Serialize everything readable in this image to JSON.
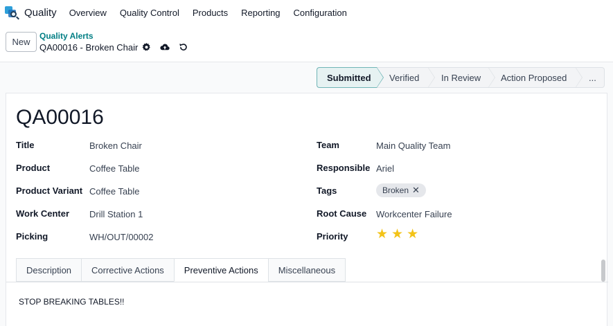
{
  "navbar": {
    "app_name": "Quality",
    "menu": [
      "Overview",
      "Quality Control",
      "Products",
      "Reporting",
      "Configuration"
    ]
  },
  "control": {
    "new_label": "New",
    "breadcrumb_parent": "Quality Alerts",
    "breadcrumb_current": "QA00016 - Broken Chair",
    "icons": [
      "gear-icon",
      "cloud-upload-icon",
      "undo-icon"
    ]
  },
  "statusbar": {
    "stages": [
      "Submitted",
      "Verified",
      "In Review",
      "Action Proposed",
      "..."
    ],
    "active_stage": "Submitted"
  },
  "form": {
    "record_name": "QA00016",
    "left_fields": [
      {
        "label": "Title",
        "value": "Broken Chair"
      },
      {
        "label": "Product",
        "value": "Coffee Table"
      },
      {
        "label": "Product Variant",
        "value": "Coffee Table"
      },
      {
        "label": "Work Center",
        "value": "Drill Station 1"
      },
      {
        "label": "Picking",
        "value": "WH/OUT/00002"
      }
    ],
    "right_fields": [
      {
        "label": "Team",
        "value": "Main Quality Team"
      },
      {
        "label": "Responsible",
        "value": "Ariel"
      },
      {
        "label": "Tags",
        "value": "Broken"
      },
      {
        "label": "Root Cause",
        "value": "Workcenter Failure"
      },
      {
        "label": "Priority",
        "value": 3
      }
    ],
    "priority_stars": 3,
    "priority_color": "#f3c318"
  },
  "notebook": {
    "tabs": [
      "Description",
      "Corrective Actions",
      "Preventive Actions",
      "Miscellaneous"
    ],
    "active_tab": "Preventive Actions",
    "content": "STOP BREAKING TABLES!!"
  },
  "colors": {
    "accent": "#017e84",
    "active_stage_bg": "#e6f2f2"
  }
}
